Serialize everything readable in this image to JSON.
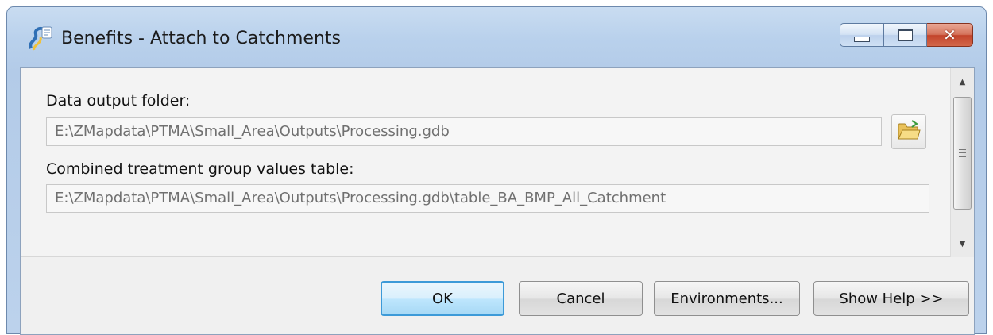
{
  "window": {
    "title": "Benefits - Attach to Catchments",
    "icon": "python-script-tool-icon",
    "caption_buttons": {
      "minimize": "minimize-icon",
      "maximize": "maximize-icon",
      "close": "✕"
    }
  },
  "params": {
    "output_folder": {
      "label": "Data output folder:",
      "value": "E:\\ZMapdata\\PTMA\\Small_Area\\Outputs\\Processing.gdb"
    },
    "values_table": {
      "label": "Combined treatment group values table:",
      "value": "E:\\ZMapdata\\PTMA\\Small_Area\\Outputs\\Processing.gdb\\table_BA_BMP_All_Catchment"
    }
  },
  "buttons": {
    "ok": "OK",
    "cancel": "Cancel",
    "environments": "Environments...",
    "show_help": "Show Help >>"
  },
  "colors": {
    "titlebar": "#b9d1ec",
    "close_button": "#c3442b",
    "default_button_border": "#3c9ad8"
  }
}
